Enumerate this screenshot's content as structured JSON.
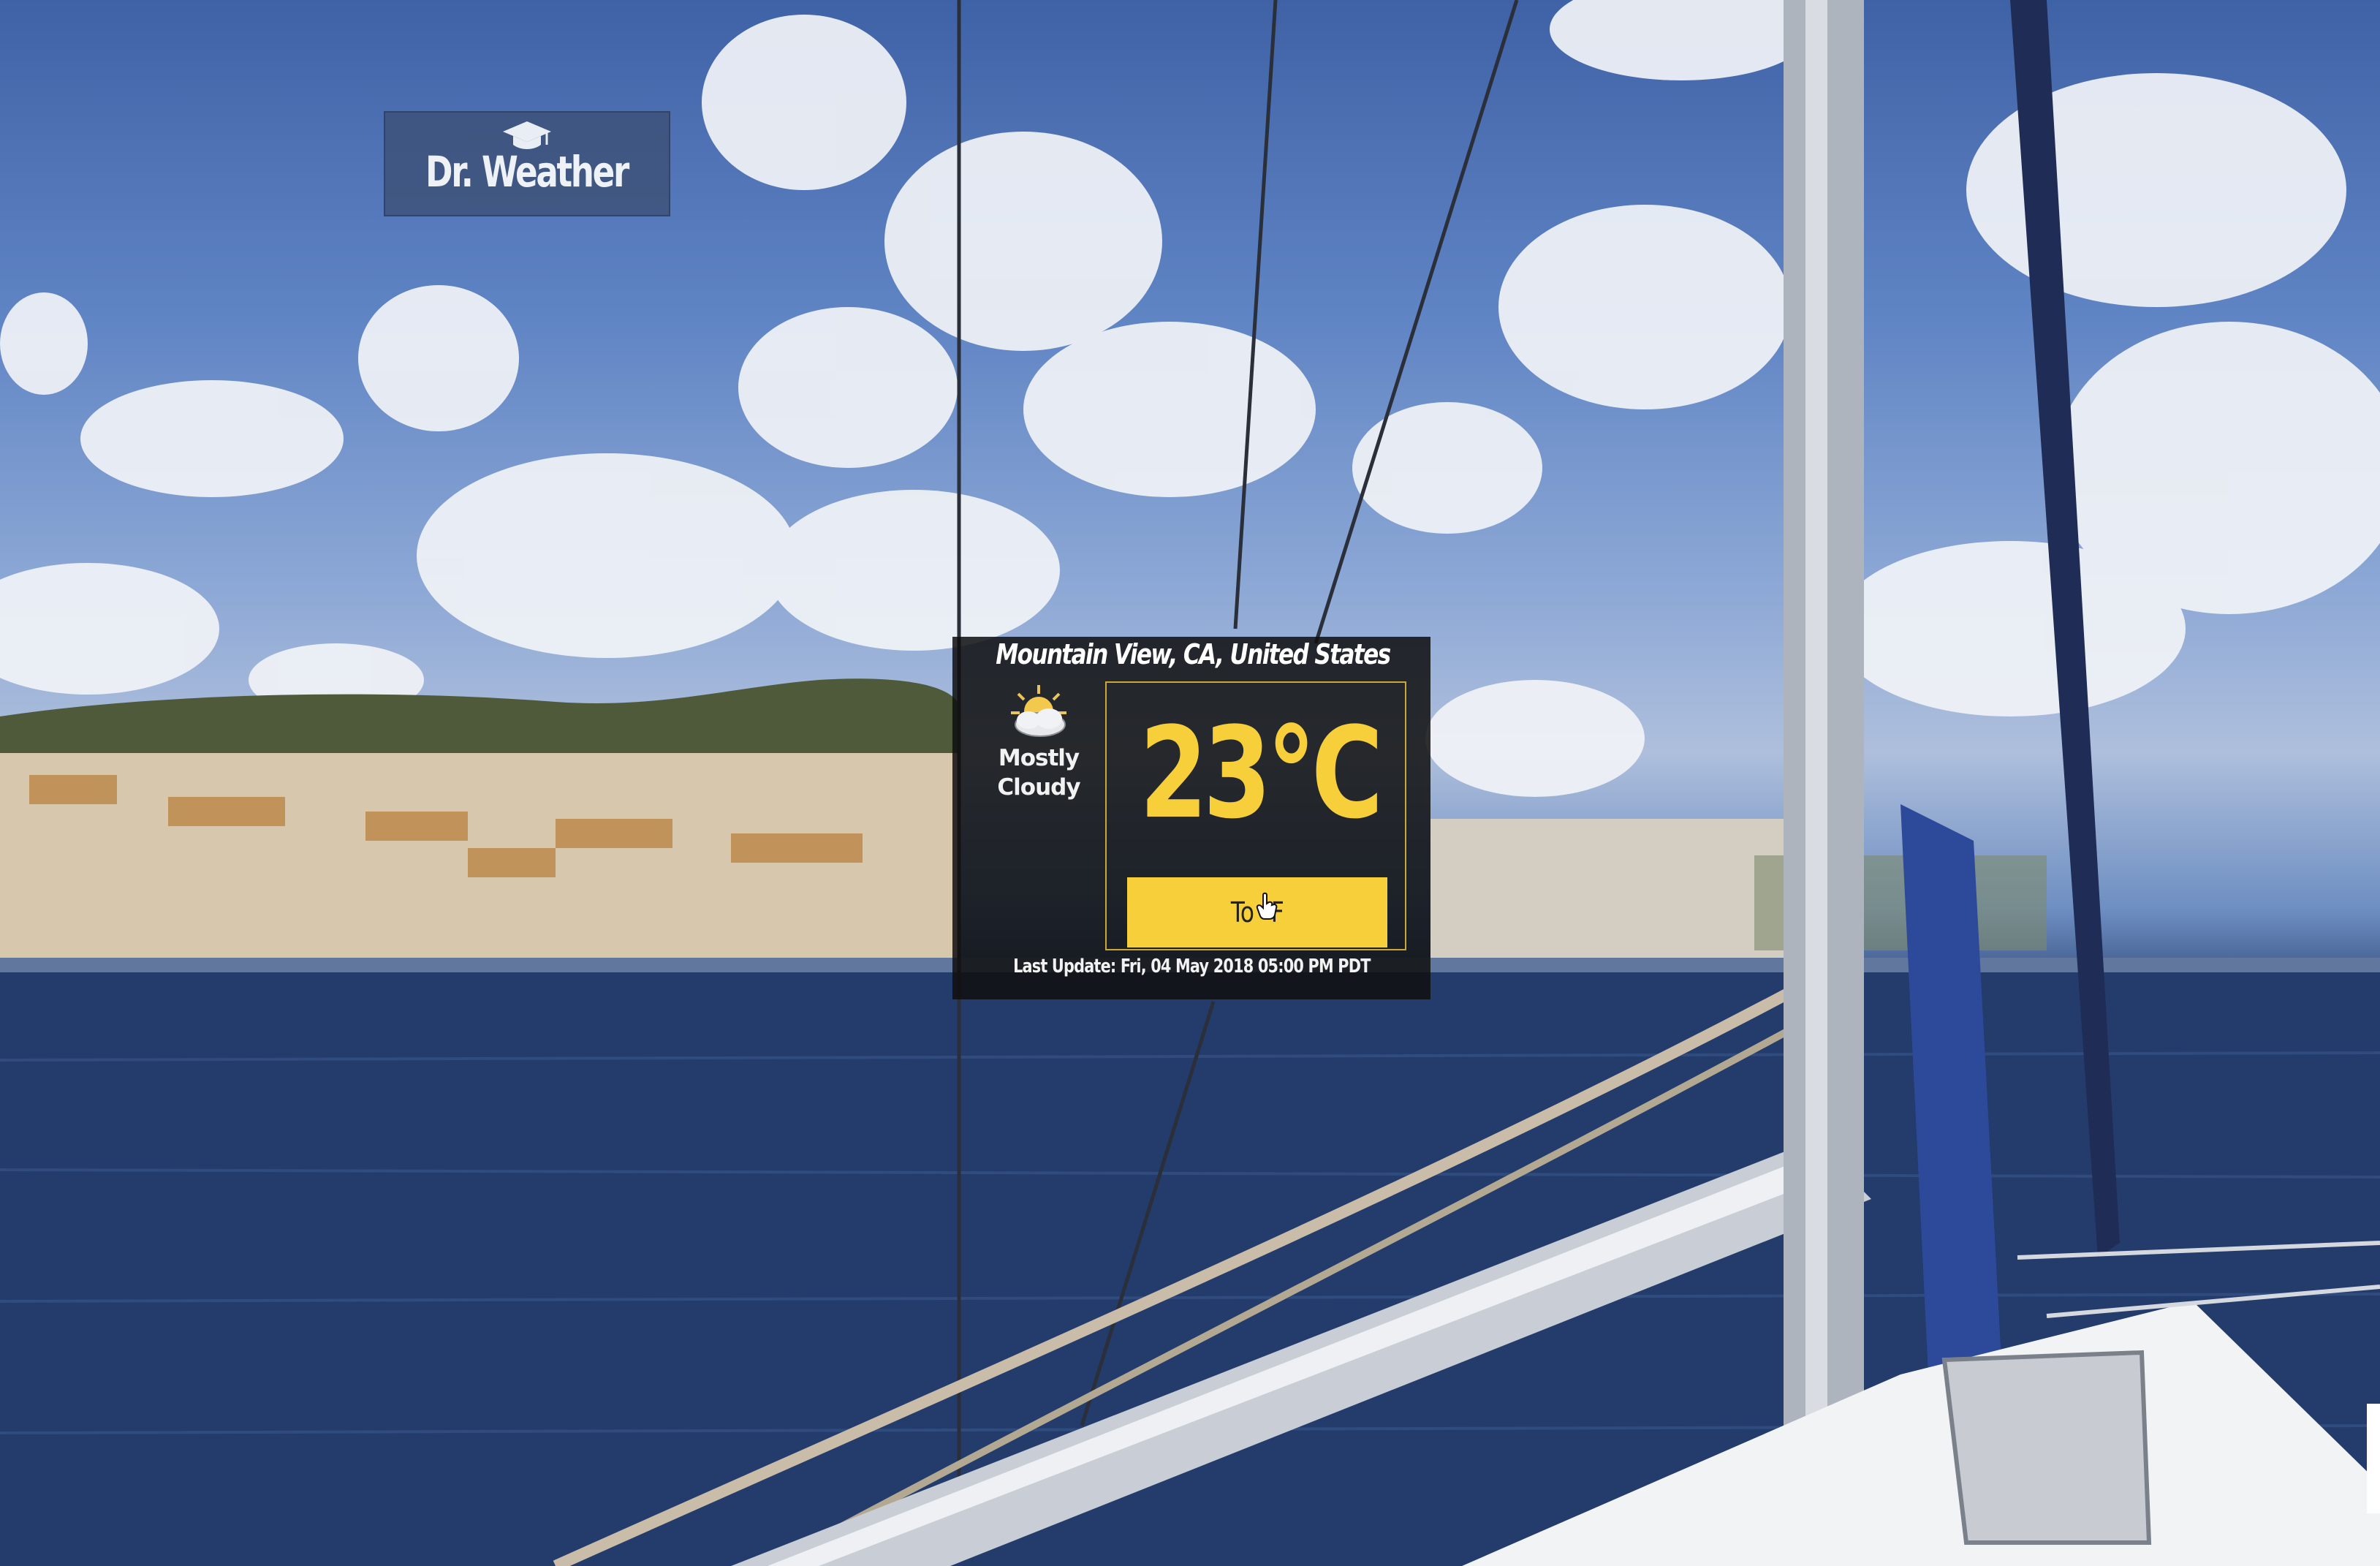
{
  "app": {
    "logo_title": "Dr. Weather",
    "logo_icon": "graduation-cap-icon"
  },
  "weather": {
    "location": "Mountain View, CA, United States",
    "condition_icon": "partly-cloudy-icon",
    "condition": "Mostly Cloudy",
    "temperature": "23°C",
    "toggle_label": "To °F",
    "last_update": "Last Update: Fri, 04 May 2018 05:00 PM PDT"
  },
  "colors": {
    "accent": "#f6cf3a",
    "card_background": "#0f0f0f",
    "logo_background": "#3c5076"
  }
}
